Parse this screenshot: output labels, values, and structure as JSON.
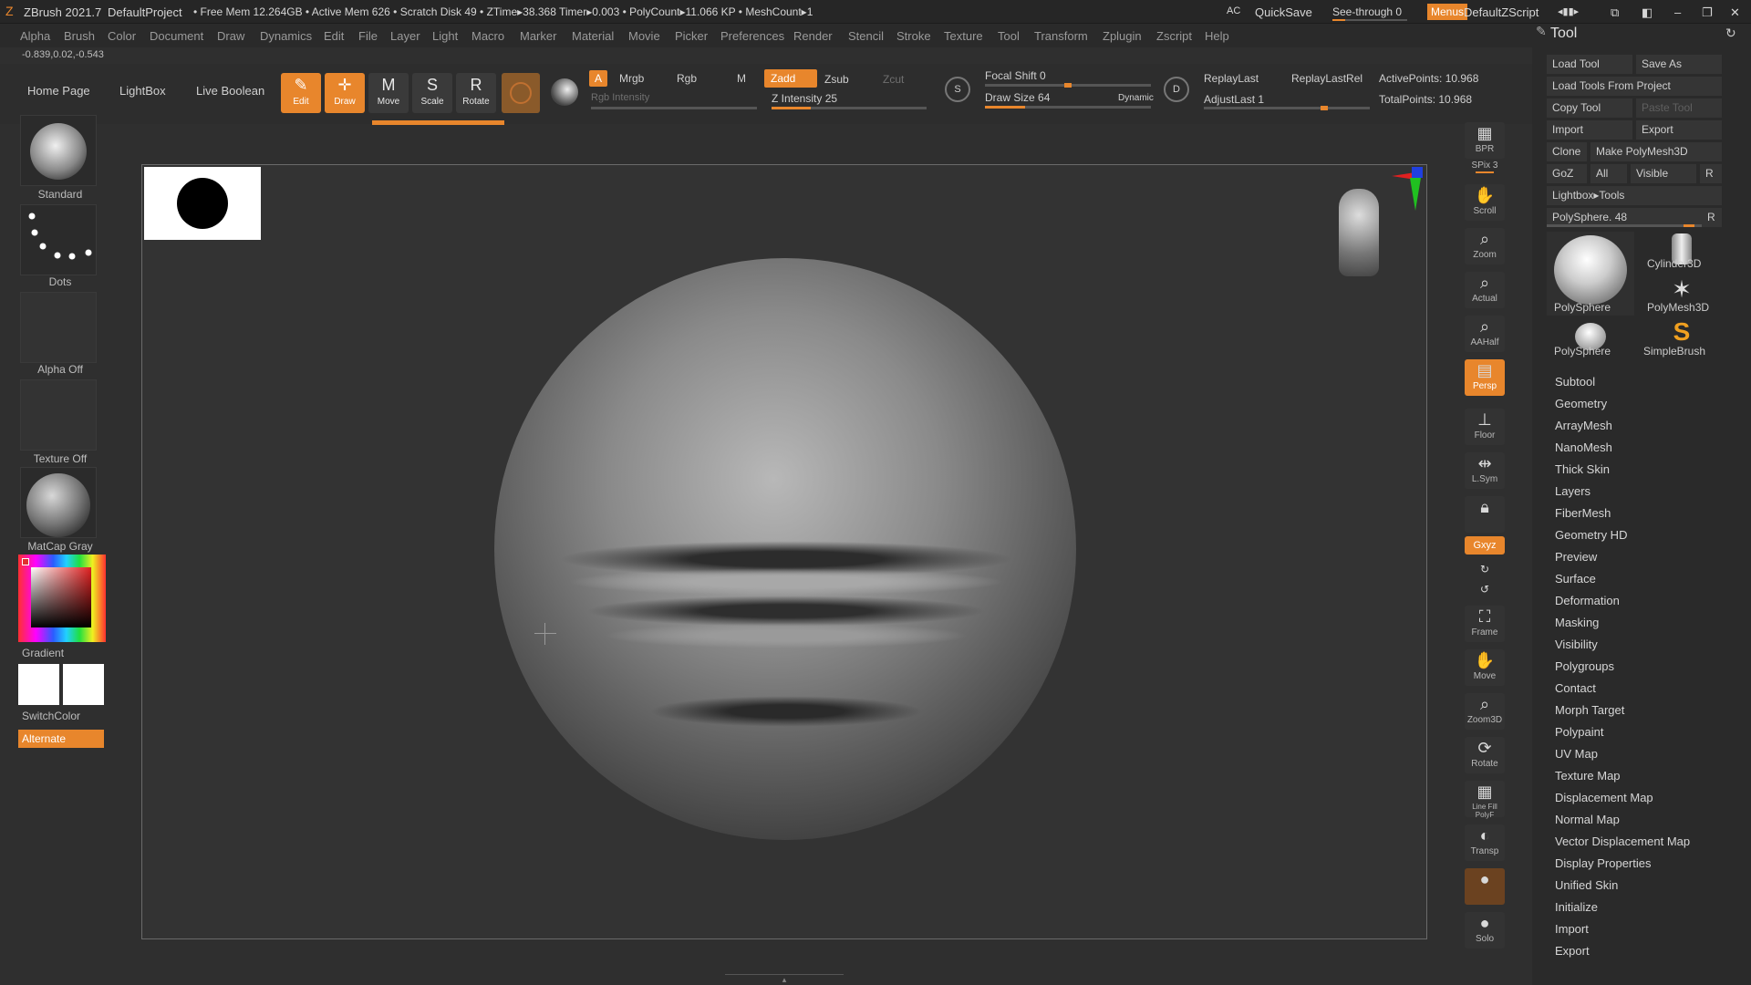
{
  "title_bar": {
    "app": "ZBrush 2021.7",
    "project": "DefaultProject",
    "stats": "• Free Mem 12.264GB • Active Mem 626 • Scratch Disk 49 • ZTime▸38.368 Timer▸0.003 • PolyCount▸11.066 KP • MeshCount▸1",
    "ac": "AC",
    "quicksave": "QuickSave",
    "seethrough": "See-through 0",
    "menus": "Menus",
    "zscript": "DefaultZScript"
  },
  "menu": [
    "Alpha",
    "Brush",
    "Color",
    "Document",
    "Draw",
    "Dynamics",
    "Edit",
    "File",
    "Layer",
    "Light",
    "Macro",
    "Marker",
    "Material",
    "Movie",
    "Picker",
    "Preferences",
    "Render",
    "Stencil",
    "Stroke",
    "Texture",
    "Tool",
    "Transform",
    "Zplugin",
    "Zscript",
    "Help"
  ],
  "coords": "-0.839,0.02,-0.543",
  "shelf": {
    "home": "Home Page",
    "lightbox": "LightBox",
    "live_boolean": "Live Boolean",
    "tools": [
      {
        "icon": "edit-icon",
        "label": "Edit"
      },
      {
        "icon": "draw-icon",
        "label": "Draw"
      },
      {
        "icon": "move-icon",
        "label": "Move"
      },
      {
        "icon": "scale-icon",
        "label": "Scale"
      },
      {
        "icon": "rotate-icon",
        "label": "Rotate"
      }
    ],
    "a": "A",
    "mrgb": "Mrgb",
    "rgb": "Rgb",
    "m": "M",
    "zadd": "Zadd",
    "zsub": "Zsub",
    "zcut": "Zcut",
    "rgb_intensity": "Rgb Intensity",
    "z_intensity": "Z Intensity 25",
    "z_intensity_value": 25,
    "focal_shift": "Focal Shift 0",
    "draw_size": "Draw Size 64",
    "dynamic": "Dynamic",
    "replay_last": "ReplayLast",
    "replay_last_rel": "ReplayLastRel",
    "adjust_last": "AdjustLast 1",
    "active_points": "ActivePoints: 10.968",
    "total_points": "TotalPoints: 10.968",
    "s": "S",
    "d": "D"
  },
  "left": {
    "brush": "Standard",
    "stroke": "Dots",
    "alpha": "Alpha Off",
    "texture": "Texture Off",
    "material": "MatCap Gray",
    "gradient": "Gradient",
    "switch_color": "SwitchColor",
    "alternate": "Alternate"
  },
  "right_toolbar": [
    {
      "icon": "bpr-icon",
      "label": "BPR"
    },
    {
      "icon": "spix-icon",
      "label": "SPix 3"
    },
    {
      "icon": "scroll-icon",
      "label": "Scroll"
    },
    {
      "icon": "zoom-icon",
      "label": "Zoom"
    },
    {
      "icon": "actual-icon",
      "label": "Actual"
    },
    {
      "icon": "aahalf-icon",
      "label": "AAHalf"
    },
    {
      "icon": "persp-icon",
      "label": "Persp"
    },
    {
      "icon": "floor-icon",
      "label": "Floor"
    },
    {
      "icon": "lsym-icon",
      "label": "L.Sym"
    },
    {
      "icon": "lock-icon",
      "label": ""
    },
    {
      "icon": "xyz-icon",
      "label": "Gxyz"
    },
    {
      "icon": "frame-icon",
      "label": "Frame"
    },
    {
      "icon": "move-icon",
      "label": "Move"
    },
    {
      "icon": "zoom3d-icon",
      "label": "Zoom3D"
    },
    {
      "icon": "rotate-icon",
      "label": "Rotate"
    },
    {
      "icon": "linefill-icon",
      "label": "Line Fill PolyF"
    },
    {
      "icon": "transp-icon",
      "label": "Transp"
    },
    {
      "icon": "ghost-icon",
      "label": ""
    },
    {
      "icon": "solo-icon",
      "label": "Solo"
    }
  ],
  "tool": {
    "title": "Tool",
    "load_tool": "Load Tool",
    "save_as": "Save As",
    "load_from_project": "Load Tools From Project",
    "copy_tool": "Copy Tool",
    "paste_tool": "Paste Tool",
    "import": "Import",
    "export": "Export",
    "clone": "Clone",
    "make_polymesh": "Make PolyMesh3D",
    "goz": "GoZ",
    "all": "All",
    "visible": "Visible",
    "r": "R",
    "lightbox_tools": "Lightbox▸Tools",
    "polysphere": "PolySphere. 48",
    "thumbs": [
      "PolySphere",
      "Cylinder3D",
      "PolyMesh3D",
      "PolySphere",
      "SimpleBrush"
    ],
    "subpalettes": [
      "Subtool",
      "Geometry",
      "ArrayMesh",
      "NanoMesh",
      "Thick Skin",
      "Layers",
      "FiberMesh",
      "Geometry HD",
      "Preview",
      "Surface",
      "Deformation",
      "Masking",
      "Visibility",
      "Polygroups",
      "Contact",
      "Morph Target",
      "Polypaint",
      "UV Map",
      "Texture Map",
      "Displacement Map",
      "Normal Map",
      "Vector Displacement Map",
      "Display Properties",
      "Unified Skin",
      "Initialize",
      "Import",
      "Export"
    ]
  },
  "colors": {
    "accent": "#e8862c",
    "bg": "#2f2f2f",
    "canvas": "#333333"
  }
}
